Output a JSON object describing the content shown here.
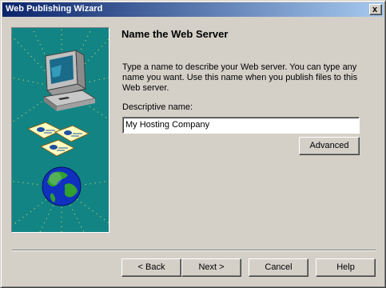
{
  "window": {
    "title": "Web Publishing Wizard",
    "close_label": "x"
  },
  "page": {
    "heading": "Name the Web Server",
    "description": "Type a name to describe your Web server. You can type any name you want. Use this name when you publish files to this Web server.",
    "field_label": "Descriptive name:",
    "field_value": "My Hosting Company",
    "advanced_label": "Advanced"
  },
  "buttons": {
    "back": "< Back",
    "next": "Next >",
    "cancel": "Cancel",
    "help": "Help"
  },
  "colors": {
    "art_background": "#138484",
    "titlebar_start": "#0a246a",
    "titlebar_end": "#a6caf0"
  }
}
